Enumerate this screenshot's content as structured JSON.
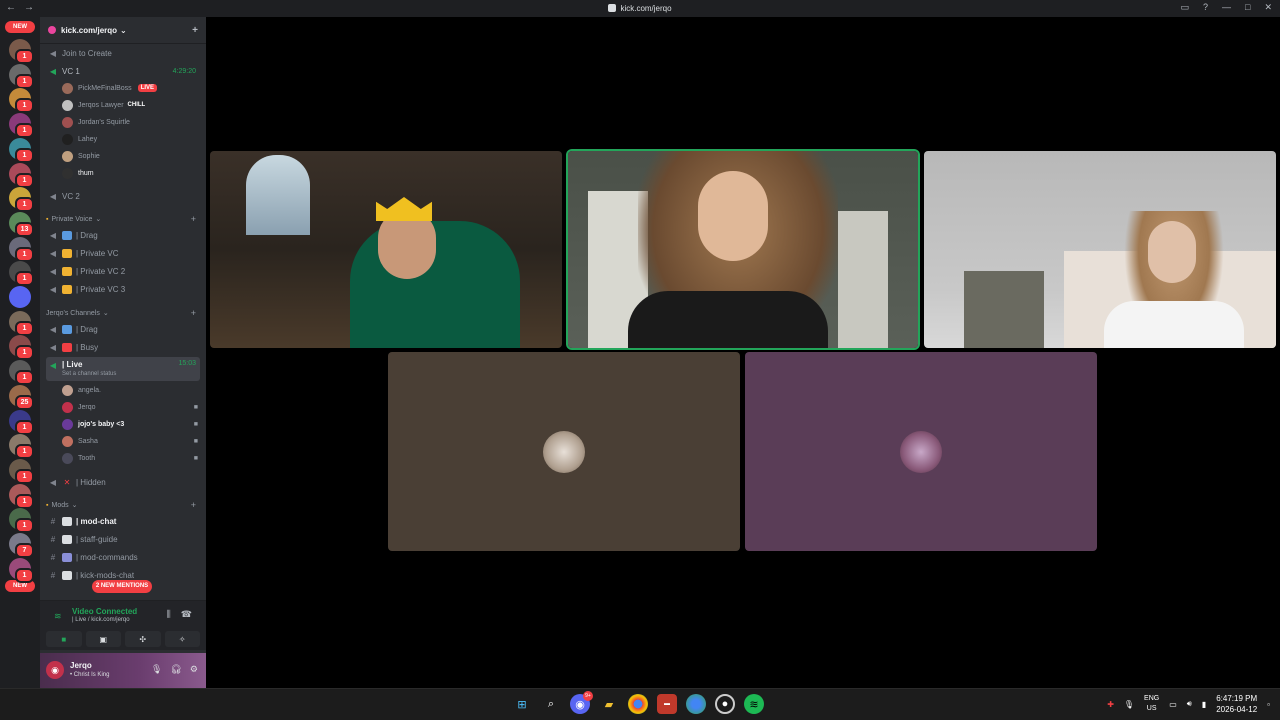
{
  "browser": {
    "url": "kick.com/jerqo",
    "back": "←",
    "forward": "→"
  },
  "server_rail": {
    "new_label": "NEW",
    "servers": [
      {
        "color": "#7a5a4a",
        "badge": "1"
      },
      {
        "color": "#6a6a6a",
        "badge": "1"
      },
      {
        "color": "#c48a3a",
        "badge": "1"
      },
      {
        "color": "#8a3a7a",
        "badge": "1"
      },
      {
        "color": "#3a8a9a",
        "badge": "1"
      },
      {
        "color": "#aa4a5a",
        "badge": "1"
      },
      {
        "color": "#caa53a",
        "badge": "1"
      },
      {
        "color": "#5a8a5a",
        "badge": "13"
      },
      {
        "color": "#6a6a7a",
        "badge": "1"
      },
      {
        "color": "#4a4a4a",
        "badge": "1"
      },
      {
        "color": "#5865f2",
        "badge": ""
      },
      {
        "color": "#7a6a5a",
        "badge": "1"
      },
      {
        "color": "#8a4a4a",
        "badge": "1"
      },
      {
        "color": "#5a5a5a",
        "badge": "1"
      },
      {
        "color": "#9a6a4a",
        "badge": "25"
      },
      {
        "color": "#3a3a8a",
        "badge": "1"
      },
      {
        "color": "#8a7a6a",
        "badge": "1"
      },
      {
        "color": "#6a5a4a",
        "badge": "1"
      },
      {
        "color": "#aa5a5a",
        "badge": "1"
      },
      {
        "color": "#4a6a4a",
        "badge": "1"
      },
      {
        "color": "#7a7a8a",
        "badge": "7"
      },
      {
        "color": "#9a4a7a",
        "badge": "1"
      }
    ],
    "bottom_new_label": "NEW"
  },
  "guild": {
    "name": "kick.com/jerqo",
    "chevron": "⌄",
    "invite_icon": "+"
  },
  "channels": {
    "join_to_create": "Join to Create",
    "vc1": {
      "name": "VC 1",
      "time": "4:29:20"
    },
    "vc1_users": [
      {
        "name": "PickMeFinalBoss",
        "live": "LIVE",
        "color": "#9a6a5a"
      },
      {
        "name": "Jerqos Lawyer",
        "tag": "CHILL",
        "color": "#c0c0c0"
      },
      {
        "name": "Jordan's Squirtle",
        "color": "#a05050"
      },
      {
        "name": "Lahey",
        "color": "#202020"
      },
      {
        "name": "Sophie",
        "color": "#c0a080"
      },
      {
        "name": "thum",
        "color": "#303030"
      }
    ],
    "vc2": "VC 2",
    "cat_private": "Private Voice",
    "private": [
      "| Drag",
      "| Private VC",
      "| Private VC 2",
      "| Private VC 3"
    ],
    "cat_jerqo": "Jerqo's Channels",
    "jerqo": [
      "| Drag",
      "| Busy"
    ],
    "live": {
      "name": "| Live",
      "time": "15:03",
      "status": "Set a channel status"
    },
    "live_users": [
      {
        "name": "angela.",
        "color": "#c0a090"
      },
      {
        "name": "Jerqo",
        "color": "#c2314b"
      },
      {
        "name": "jojo's baby <3",
        "color": "#6a3a9a"
      },
      {
        "name": "Sasha",
        "color": "#c07060"
      },
      {
        "name": "Tooth",
        "color": "#4a4a5a"
      }
    ],
    "hidden": "| Hidden",
    "cat_mods": "Mods",
    "mods": [
      "| mod-chat",
      "| staff-guide",
      "| mod-commands",
      "| kick-mods-chat"
    ],
    "mentions": "2 NEW MENTIONS"
  },
  "voice_status": {
    "title": "Video Connected",
    "sub": "| Live / kick.com/jerqo"
  },
  "user_panel": {
    "name": "Jerqo",
    "status": "• Christ Is King"
  },
  "stage": {
    "accent_speaking": "#23a55a"
  },
  "taskbar": {
    "lang_top": "ENG",
    "lang_bottom": "US",
    "time": "6:47:19 PM",
    "date": "2026-04-12",
    "discord_badge": "9+"
  }
}
